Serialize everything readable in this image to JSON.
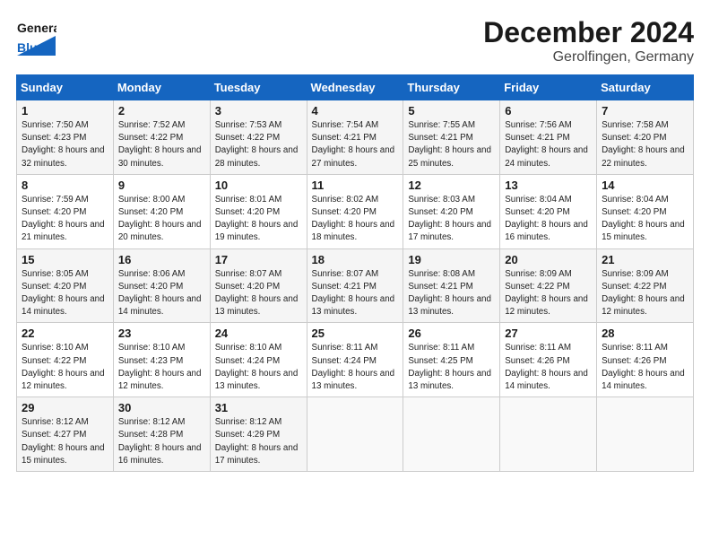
{
  "header": {
    "logo_general": "General",
    "logo_blue": "Blue",
    "month": "December 2024",
    "location": "Gerolfingen, Germany"
  },
  "days_of_week": [
    "Sunday",
    "Monday",
    "Tuesday",
    "Wednesday",
    "Thursday",
    "Friday",
    "Saturday"
  ],
  "weeks": [
    [
      {
        "day": "1",
        "sunrise": "7:50 AM",
        "sunset": "4:23 PM",
        "daylight": "8 hours and 32 minutes."
      },
      {
        "day": "2",
        "sunrise": "7:52 AM",
        "sunset": "4:22 PM",
        "daylight": "8 hours and 30 minutes."
      },
      {
        "day": "3",
        "sunrise": "7:53 AM",
        "sunset": "4:22 PM",
        "daylight": "8 hours and 28 minutes."
      },
      {
        "day": "4",
        "sunrise": "7:54 AM",
        "sunset": "4:21 PM",
        "daylight": "8 hours and 27 minutes."
      },
      {
        "day": "5",
        "sunrise": "7:55 AM",
        "sunset": "4:21 PM",
        "daylight": "8 hours and 25 minutes."
      },
      {
        "day": "6",
        "sunrise": "7:56 AM",
        "sunset": "4:21 PM",
        "daylight": "8 hours and 24 minutes."
      },
      {
        "day": "7",
        "sunrise": "7:58 AM",
        "sunset": "4:20 PM",
        "daylight": "8 hours and 22 minutes."
      }
    ],
    [
      {
        "day": "8",
        "sunrise": "7:59 AM",
        "sunset": "4:20 PM",
        "daylight": "8 hours and 21 minutes."
      },
      {
        "day": "9",
        "sunrise": "8:00 AM",
        "sunset": "4:20 PM",
        "daylight": "8 hours and 20 minutes."
      },
      {
        "day": "10",
        "sunrise": "8:01 AM",
        "sunset": "4:20 PM",
        "daylight": "8 hours and 19 minutes."
      },
      {
        "day": "11",
        "sunrise": "8:02 AM",
        "sunset": "4:20 PM",
        "daylight": "8 hours and 18 minutes."
      },
      {
        "day": "12",
        "sunrise": "8:03 AM",
        "sunset": "4:20 PM",
        "daylight": "8 hours and 17 minutes."
      },
      {
        "day": "13",
        "sunrise": "8:04 AM",
        "sunset": "4:20 PM",
        "daylight": "8 hours and 16 minutes."
      },
      {
        "day": "14",
        "sunrise": "8:04 AM",
        "sunset": "4:20 PM",
        "daylight": "8 hours and 15 minutes."
      }
    ],
    [
      {
        "day": "15",
        "sunrise": "8:05 AM",
        "sunset": "4:20 PM",
        "daylight": "8 hours and 14 minutes."
      },
      {
        "day": "16",
        "sunrise": "8:06 AM",
        "sunset": "4:20 PM",
        "daylight": "8 hours and 14 minutes."
      },
      {
        "day": "17",
        "sunrise": "8:07 AM",
        "sunset": "4:20 PM",
        "daylight": "8 hours and 13 minutes."
      },
      {
        "day": "18",
        "sunrise": "8:07 AM",
        "sunset": "4:21 PM",
        "daylight": "8 hours and 13 minutes."
      },
      {
        "day": "19",
        "sunrise": "8:08 AM",
        "sunset": "4:21 PM",
        "daylight": "8 hours and 13 minutes."
      },
      {
        "day": "20",
        "sunrise": "8:09 AM",
        "sunset": "4:22 PM",
        "daylight": "8 hours and 12 minutes."
      },
      {
        "day": "21",
        "sunrise": "8:09 AM",
        "sunset": "4:22 PM",
        "daylight": "8 hours and 12 minutes."
      }
    ],
    [
      {
        "day": "22",
        "sunrise": "8:10 AM",
        "sunset": "4:22 PM",
        "daylight": "8 hours and 12 minutes."
      },
      {
        "day": "23",
        "sunrise": "8:10 AM",
        "sunset": "4:23 PM",
        "daylight": "8 hours and 12 minutes."
      },
      {
        "day": "24",
        "sunrise": "8:10 AM",
        "sunset": "4:24 PM",
        "daylight": "8 hours and 13 minutes."
      },
      {
        "day": "25",
        "sunrise": "8:11 AM",
        "sunset": "4:24 PM",
        "daylight": "8 hours and 13 minutes."
      },
      {
        "day": "26",
        "sunrise": "8:11 AM",
        "sunset": "4:25 PM",
        "daylight": "8 hours and 13 minutes."
      },
      {
        "day": "27",
        "sunrise": "8:11 AM",
        "sunset": "4:26 PM",
        "daylight": "8 hours and 14 minutes."
      },
      {
        "day": "28",
        "sunrise": "8:11 AM",
        "sunset": "4:26 PM",
        "daylight": "8 hours and 14 minutes."
      }
    ],
    [
      {
        "day": "29",
        "sunrise": "8:12 AM",
        "sunset": "4:27 PM",
        "daylight": "8 hours and 15 minutes."
      },
      {
        "day": "30",
        "sunrise": "8:12 AM",
        "sunset": "4:28 PM",
        "daylight": "8 hours and 16 minutes."
      },
      {
        "day": "31",
        "sunrise": "8:12 AM",
        "sunset": "4:29 PM",
        "daylight": "8 hours and 17 minutes."
      },
      null,
      null,
      null,
      null
    ]
  ],
  "labels": {
    "sunrise": "Sunrise:",
    "sunset": "Sunset:",
    "daylight": "Daylight:"
  }
}
